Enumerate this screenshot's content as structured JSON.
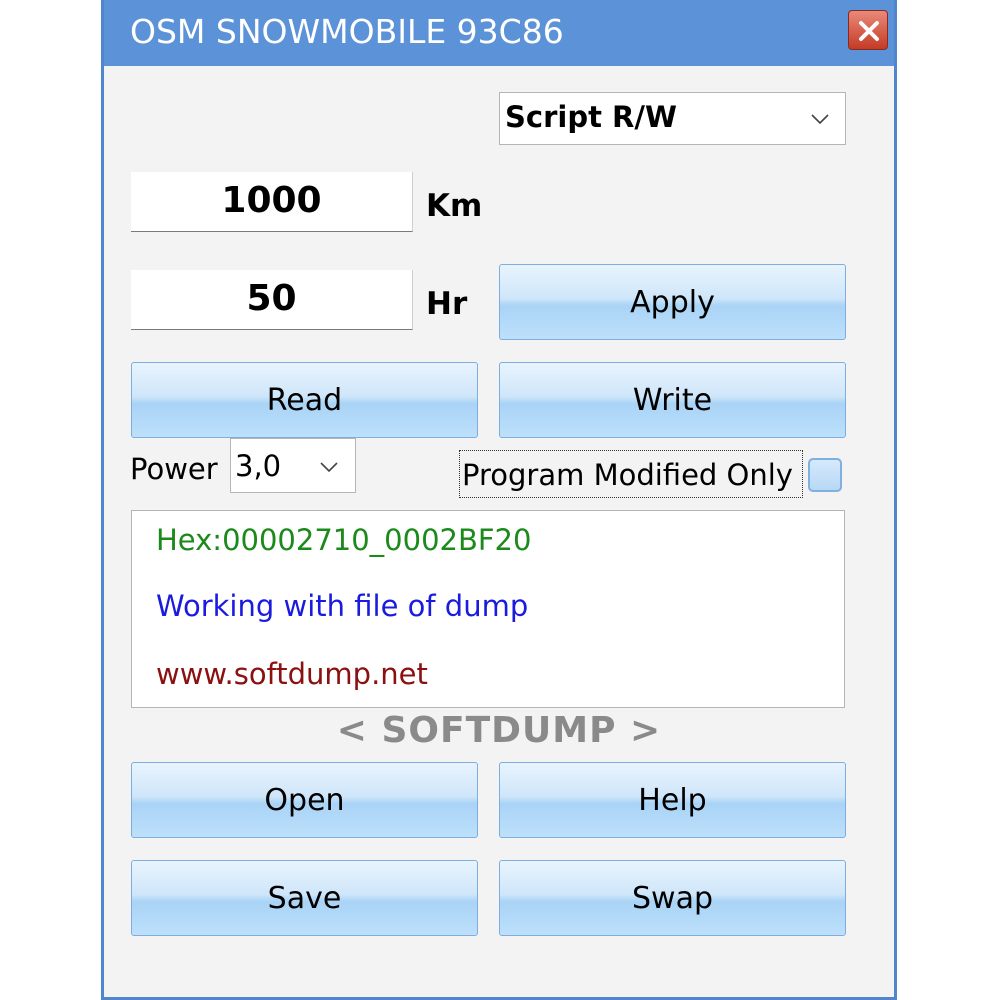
{
  "window": {
    "title": "OSM SNOWMOBILE 93C86",
    "close_icon": "close-icon"
  },
  "script_select": {
    "value": "Script R/W"
  },
  "km": {
    "value": "1000",
    "unit": "Km"
  },
  "hr": {
    "value": "50",
    "unit": "Hr"
  },
  "buttons": {
    "apply": "Apply",
    "read": "Read",
    "write": "Write",
    "open": "Open",
    "help": "Help",
    "save": "Save",
    "swap": "Swap"
  },
  "power": {
    "label": "Power",
    "value": "3,0"
  },
  "program_modified": {
    "label": "Program Modified Only",
    "checked": false
  },
  "info": {
    "hex": "Hex:00002710_0002BF20",
    "status": "Working with file of dump",
    "website": "www.softdump.net"
  },
  "brand": "< SOFTDUMP >",
  "colors": {
    "titlebar": "#5b92d8",
    "hex_text": "#1b8a1b",
    "status_text": "#1b1be0",
    "website_text": "#8b1010",
    "brand_text": "#8a8a8a"
  }
}
